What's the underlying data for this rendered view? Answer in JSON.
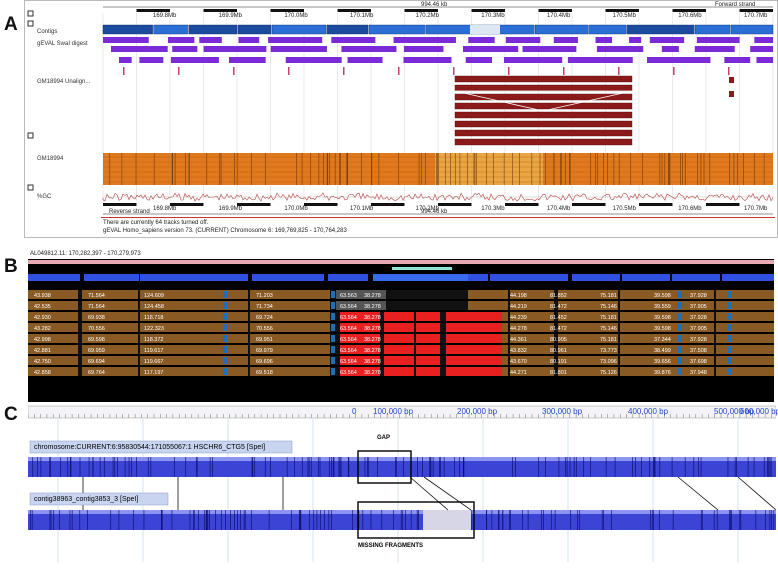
{
  "panels": {
    "a": "A",
    "b": "B",
    "c": "C"
  },
  "panel_a": {
    "ruler_span": "994.46 kb",
    "strand_forward": "Forward strand",
    "strand_reverse": "Reverse strand",
    "ticks_top": [
      "169.8Mb",
      "169.9Mb",
      "170.0Mb",
      "170.1Mb",
      "170.2Mb",
      "170.3Mb",
      "170.4Mb",
      "170.5Mb",
      "170.6Mb",
      "170.7Mb"
    ],
    "ticks_bottom": [
      "169.8Mb",
      "169.9Mb",
      "170.0Mb",
      "170.1Mb",
      "170.2Mb",
      "170.3Mb",
      "170.4Mb",
      "170.5Mb",
      "170.6Mb",
      "170.7Mb"
    ],
    "tracks": {
      "contigs": "Contigs",
      "digest": "gEVAL SwaI digest",
      "unaligned": "GM18994 Unalign...",
      "gm": "GM18994",
      "gc": "%GC"
    },
    "footer_line1": "There are currently 64 tracks turned off.",
    "footer_line2": "gEVAL Homo_sapiens version 73. (CURRENT) Chromosome 6: 169,769,825 - 170,764,283"
  },
  "panel_b": {
    "header": "AL049812.11: 170,282,397 - 170,279,973",
    "values_grid": [
      [
        "43.938",
        "71.564",
        "124.609",
        "71.203",
        "63.563",
        "38.278",
        "44.198",
        "81.852",
        "75.181",
        "39.598",
        "37.928"
      ],
      [
        "42.535",
        "71.564",
        "124.458",
        "71.734",
        "63.564",
        "38.278",
        "44.219",
        "81.472",
        "75.146",
        "39.559",
        "37.905"
      ],
      [
        "42.930",
        "69.938",
        "118.718",
        "69.724",
        "63.564",
        "38.278",
        "44.239",
        "81.452",
        "75.181",
        "39.598",
        "37.928"
      ],
      [
        "43.282",
        "70.556",
        "122.323",
        "70.556",
        "63.564",
        "38.278",
        "44.278",
        "81.472",
        "75.146",
        "39.598",
        "37.905"
      ],
      [
        "42.998",
        "69.598",
        "118.372",
        "69.951",
        "63.564",
        "38.278",
        "44.361",
        "80.905",
        "75.181",
        "37.344",
        "37.928"
      ],
      [
        "42.881",
        "69.959",
        "119.617",
        "69.979",
        "63.564",
        "38.278",
        "43.832",
        "80.961",
        "73.773",
        "38.499",
        "37.508"
      ],
      [
        "42.750",
        "69.694",
        "119.667",
        "69.696",
        "63.564",
        "38.278",
        "43.670",
        "80.191",
        "73.096",
        "39.656",
        "37.698"
      ],
      [
        "42.858",
        "69.764",
        "117.197",
        "69.518",
        "63.564",
        "38.278",
        "44.271",
        "81.801",
        "75.126",
        "39.876",
        "37.948"
      ]
    ]
  },
  "panel_c": {
    "axis_ticks": [
      "0",
      "100,000 bp",
      "200,000 bp",
      "300,000 bp",
      "400,000 bp",
      "500,000 bp",
      "600,000 bp"
    ],
    "chrom_label": "chromosome:CURRENT:6:95830544:171055067:1 HSCHR6_CTG5 [SpeI]",
    "contig_label": "contig38963_contig3853_3 [SpeI]",
    "gap_label": "GAP",
    "missing_label": "MISSING FRAGMENTS"
  },
  "colors": {
    "orange": "#e07a1e",
    "purple": "#7a2ad6",
    "maroon": "#8b1a1a",
    "blue": "#2f3fcf",
    "red": "#e82020",
    "brown": "#8a5a24"
  }
}
